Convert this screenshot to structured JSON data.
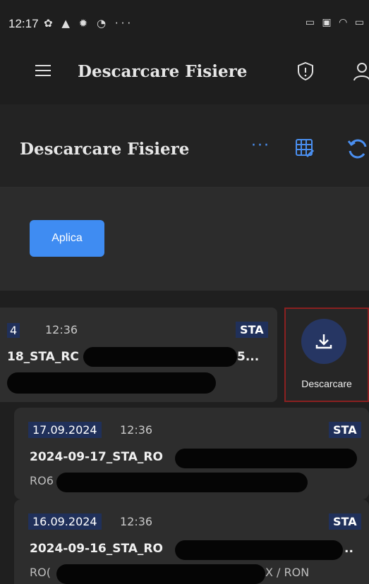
{
  "status_bar": {
    "time": "12:17",
    "left_icons": "✿ ▲ ✹ ◔ ···",
    "right_icons": "▭ ▣ ◠ ▭"
  },
  "app_bar": {
    "title": "Descarcare Fisiere",
    "icons": [
      "menu-icon",
      "shield-alert-icon",
      "user-icon"
    ]
  },
  "sub_header": {
    "title": "Descarcare Fisiere",
    "more_label": "···",
    "icons": [
      "more-dots-icon",
      "grid-edit-icon",
      "refresh-icon"
    ]
  },
  "filter": {
    "apply_label": "Aplica"
  },
  "swiped_row": {
    "date": "4",
    "time": "12:36",
    "type": "STA",
    "name": "18_STA_RC",
    "name_end": "5...",
    "action_label": "Descarcare",
    "action_icon": "download-icon"
  },
  "cards": [
    {
      "date": "17.09.2024",
      "time": "12:36",
      "type": "STA",
      "name": "2024-09-17_STA_RO",
      "sub": "RO6"
    },
    {
      "date": "16.09.2024",
      "time": "12:36",
      "type": "STA",
      "name": "2024-09-16_STA_RO",
      "name_end": "..",
      "sub": "RO(",
      "sub_end": "X / RON"
    }
  ],
  "colors": {
    "accent": "#3f8cf2",
    "badge_bg": "#20305a",
    "highlight_border": "#8a2020",
    "background": "#1f1f1f"
  }
}
